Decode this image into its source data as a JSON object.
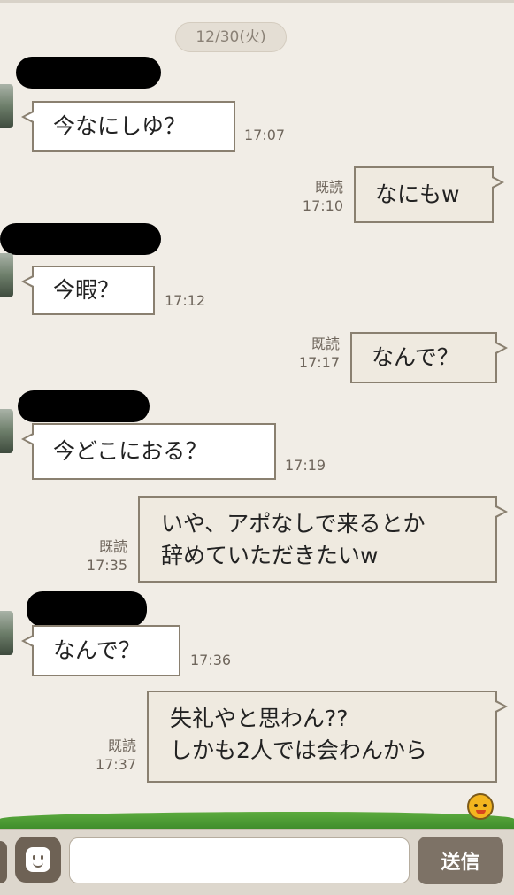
{
  "date_separator": "12/30(火)",
  "messages": [
    {
      "direction": "in",
      "text": "今なにしゆ？",
      "time": "17:07"
    },
    {
      "direction": "out",
      "text": "なにもw",
      "read": "既読",
      "time": "17:10"
    },
    {
      "direction": "in",
      "text": "今暇？",
      "time": "17:12"
    },
    {
      "direction": "out",
      "text": "なんで？",
      "read": "既読",
      "time": "17:17"
    },
    {
      "direction": "in",
      "text": "今どこにおる？",
      "time": "17:19"
    },
    {
      "direction": "out",
      "lines": [
        "いや、アポなしで来るとか",
        "辞めていただきたいw"
      ],
      "read": "既読",
      "time": "17:35"
    },
    {
      "direction": "in",
      "text": "なんで？",
      "time": "17:36"
    },
    {
      "direction": "out",
      "lines": [
        "失礼やと思わん??",
        "しかも2人では会わんから"
      ],
      "read": "既読",
      "time": "17:37"
    }
  ],
  "input": {
    "placeholder": "",
    "value": ""
  },
  "send_label": "送信",
  "icons": {
    "emoji": "emoji-face-icon",
    "mascot": "mascot-sticker-icon"
  },
  "colors": {
    "background": "#f1ede6",
    "bubble_border": "#8a8070",
    "outgoing_bubble": "#efeae0",
    "send_button": "#7d7266",
    "grass": "#3e8c2b"
  }
}
